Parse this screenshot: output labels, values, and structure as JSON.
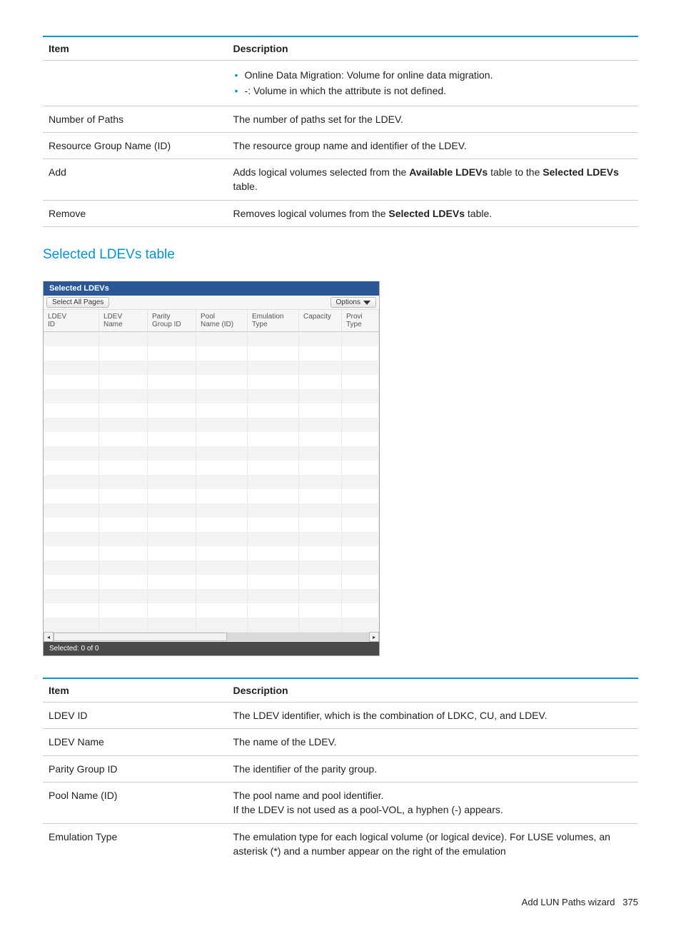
{
  "top_table": {
    "head_item": "Item",
    "head_desc": "Description",
    "row_bullets": [
      "Online Data Migration: Volume for online data migration.",
      "-: Volume in which the attribute is not defined."
    ],
    "num_paths_item": "Number of Paths",
    "num_paths_desc": "The number of paths set for the LDEV.",
    "rg_item": "Resource Group Name (ID)",
    "rg_desc": "The resource group name and identifier of the LDEV.",
    "add_item": "Add",
    "add_desc1": "Adds logical volumes selected from the ",
    "add_b1": "Available LDEVs",
    "add_desc2": " table to the ",
    "add_b2": "Selected LDEVs",
    "add_desc3": " table.",
    "remove_item": "Remove",
    "remove_desc1": "Removes logical volumes from the ",
    "remove_b1": "Selected LDEVs",
    "remove_desc2": " table."
  },
  "heading": "Selected LDEVs table",
  "app": {
    "title": "Selected LDEVs",
    "select_all": "Select All Pages",
    "options": "Options",
    "cols": [
      "LDEV ID",
      "LDEV Name",
      "Parity Group ID",
      "Pool Name (ID)",
      "Emulation Type",
      "Capacity",
      "Provi Type"
    ],
    "widths": [
      78,
      68,
      68,
      72,
      72,
      60,
      52
    ],
    "selected_bar": "Selected:  0   of  0"
  },
  "bottom_table": {
    "head_item": "Item",
    "head_desc": "Description",
    "r1_item": "LDEV ID",
    "r1_desc": "The LDEV identifier, which is the combination of LDKC, CU, and LDEV.",
    "r2_item": "LDEV Name",
    "r2_desc": "The name of the LDEV.",
    "r3_item": "Parity Group ID",
    "r3_desc": "The identifier of the parity group.",
    "r4_item": "Pool Name (ID)",
    "r4_desc_l1": "The pool name and pool identifier.",
    "r4_desc_l2": "If the LDEV is not used as a pool-VOL, a hyphen (-) appears.",
    "r5_item": "Emulation Type",
    "r5_desc": "The emulation type for each logical volume (or logical device). For LUSE volumes, an asterisk (*) and a number appear on the right of the emulation"
  },
  "footer": {
    "text": "Add LUN Paths wizard",
    "page": "375"
  }
}
